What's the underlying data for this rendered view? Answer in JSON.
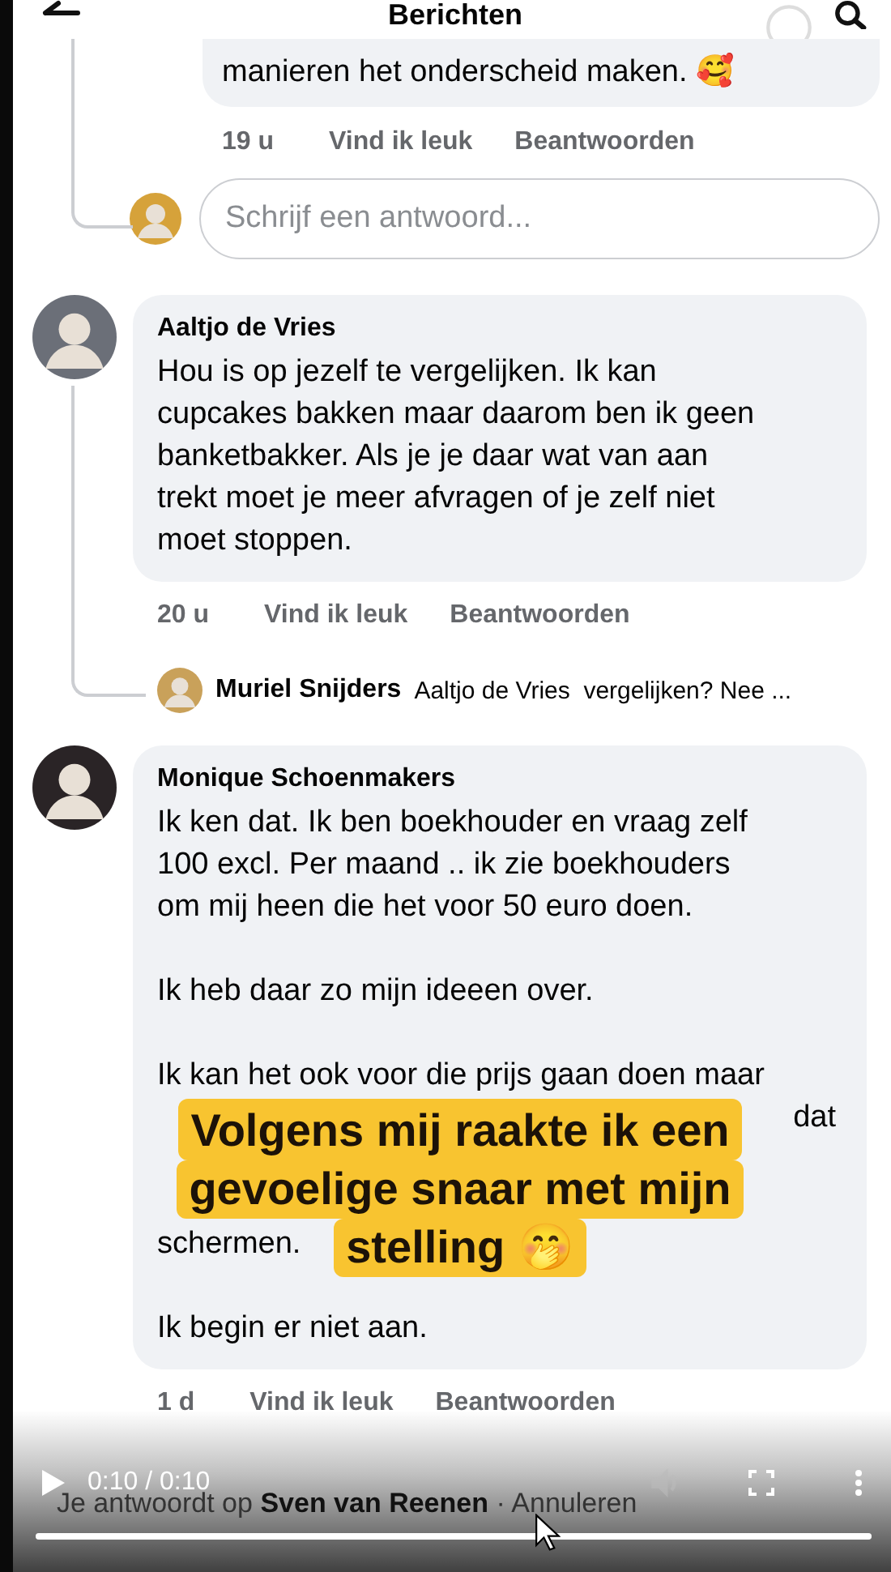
{
  "header": {
    "title": "Berichten"
  },
  "comments": [
    {
      "kind": "partial",
      "paragraphs": [
        [
          "manieren het onderscheid maken. 🥰"
        ]
      ],
      "time": "19 u",
      "actions": [
        {
          "kind": "like",
          "label": "Vind ik leuk"
        },
        {
          "kind": "reply",
          "label": "Beantwoorden"
        }
      ],
      "reply_field": {
        "placeholder": "Schrijf een antwoord..."
      }
    },
    {
      "kind": "full",
      "author": "Aaltjo de Vries",
      "paragraphs": [
        [
          "Hou is op jezelf te vergelijken. Ik kan",
          "cupcakes bakken maar daarom ben ik geen",
          "banketbakker. Als je je daar wat van aan",
          "trekt moet je meer afvragen of je zelf niet",
          "moet stoppen."
        ]
      ],
      "time": "20 u",
      "actions": [
        {
          "kind": "like",
          "label": "Vind ik leuk"
        },
        {
          "kind": "reply",
          "label": "Beantwoorden"
        }
      ],
      "replies": [
        {
          "author": "Muriel Snijders",
          "text": "Aaltjo de Vries  vergelijken? Nee ..."
        }
      ]
    },
    {
      "kind": "full",
      "author": "Monique Schoenmakers",
      "paragraphs": [
        [
          "Ik ken dat. Ik ben boekhouder en vraag zelf",
          "100 excl. Per maand .. ik zie boekhouders",
          "om mij heen die het voor 50 euro doen."
        ],
        [
          "Ik heb daar zo mijn ideeen over."
        ],
        [
          "Ik kan het ook voor die prijs gaan doen maar",
          {
            "kind": "fragment",
            "text": "dat"
          },
          "schermen."
        ],
        [
          "Ik begin er niet aan."
        ]
      ],
      "time": "1 d",
      "actions": [
        {
          "kind": "like",
          "label": "Vind ik leuk"
        },
        {
          "kind": "reply",
          "label": "Beantwoorden"
        }
      ],
      "caption": [
        "Volgens mij raakte ik een",
        "gevoelige snaar met mijn",
        "stelling 🤭"
      ]
    }
  ],
  "reply_bar": {
    "text": "Je antwoordt op **Sven van Reenen** · Annuleren"
  },
  "player": {
    "time": "0:10 / 0:10",
    "progress": {
      "level": 1
    }
  }
}
